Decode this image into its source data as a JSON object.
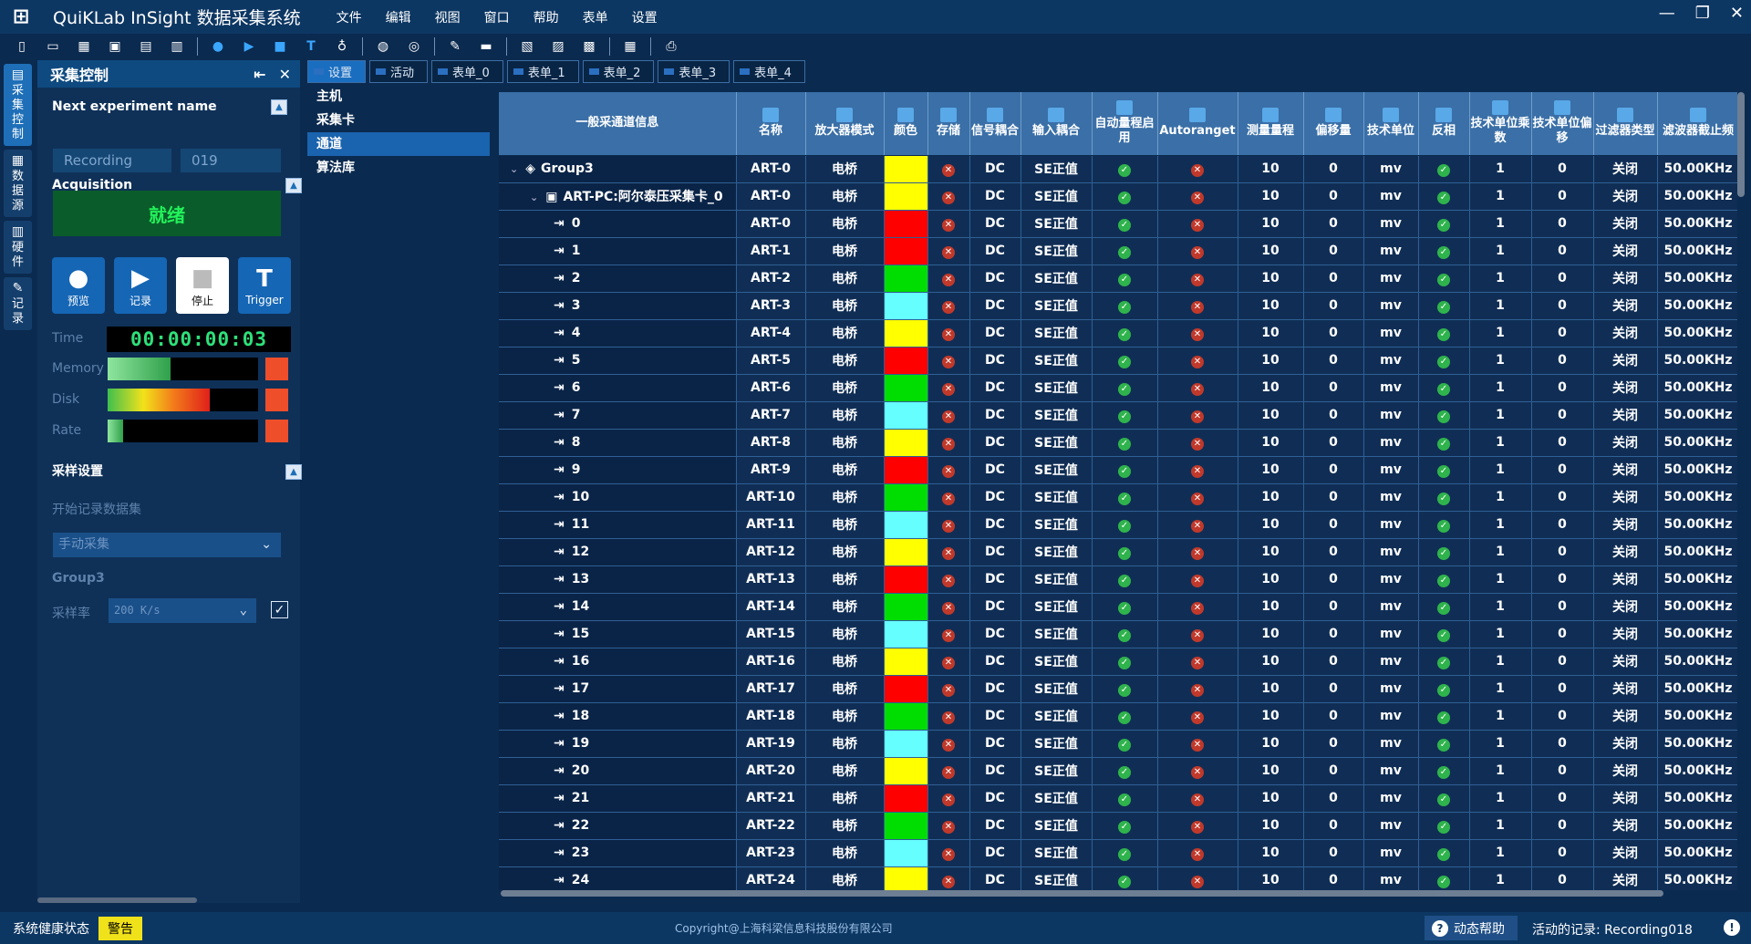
{
  "app": {
    "title": "QuiKLab InSight 数据采集系统",
    "menu": [
      "文件",
      "编辑",
      "视图",
      "窗口",
      "帮助",
      "表单",
      "设置"
    ]
  },
  "toolbar": {
    "icons": [
      "new-file-icon",
      "open-folder-icon",
      "grid-icon",
      "module-icon",
      "save-icon",
      "save-all-icon",
      "record-dot-icon",
      "play-icon",
      "stop-square-icon",
      "trigger-icon",
      "microphone-icon",
      "info-circle-icon",
      "at-circle-icon",
      "pen-icon",
      "print-icon",
      "calendar-1-icon",
      "calendar-2-icon",
      "calendar-3-icon",
      "calculator-icon",
      "printer-icon"
    ]
  },
  "rail": {
    "tabs": [
      {
        "label": "采\n集\n控\n制",
        "active": true
      },
      {
        "label": "数\n据\n源",
        "active": false
      },
      {
        "label": "硬\n件",
        "active": false
      },
      {
        "label": "记\n录",
        "active": false
      }
    ]
  },
  "left_panel": {
    "title": "采集控制",
    "next_experiment_label": "Next experiment name",
    "experiment_name": "Recording",
    "experiment_number": "019",
    "acquisition_label": "Acquisition",
    "status": "就绪",
    "buttons": {
      "preview": "预览",
      "record": "记录",
      "stop": "停止",
      "trigger": "Trigger"
    },
    "time_label": "Time",
    "time_value": "00:00:00:03",
    "memory_label": "Memory",
    "disk_label": "Disk",
    "rate_label": "Rate",
    "memory_level": 0.42,
    "disk_level": 0.68,
    "rate_level": 0.1,
    "sampling_settings_label": "采样设置",
    "start_record_label": "开始记录数据集",
    "mode_value": "手动采集",
    "group_label": "Group3",
    "sample_rate_label": "采样率",
    "sample_rate_value": "200 K/s"
  },
  "tabs": [
    "设置",
    "活动",
    "表单_0",
    "表单_1",
    "表单_2",
    "表单_3",
    "表单_4"
  ],
  "tree": [
    "主机",
    "采集卡",
    "通道",
    "算法库"
  ],
  "grid": {
    "headers": [
      "一般采通道信息",
      "名称",
      "放大器模式",
      "颜色",
      "存储",
      "信号耦合",
      "输入耦合",
      "自动量程启用",
      "Autoranget",
      "测量量程",
      "偏移量",
      "技术单位",
      "反相",
      "技术单位乘数",
      "技术单位偏移",
      "过滤器类型",
      "滤波器截止频"
    ],
    "group_row": {
      "label": "Group3",
      "name": "ART-0"
    },
    "device_row": {
      "label": "ART-PC:阿尔泰压采集卡_0",
      "name": "ART-0"
    },
    "amp_mode": "电桥",
    "signal_coupling": "DC",
    "input_coupling": "SE正值",
    "range": "10",
    "offset": "0",
    "unit": "mv",
    "multiplier": "1",
    "unit_offset": "0",
    "filter": "关闭",
    "cutoff": "50.00KHz",
    "color_cycle": [
      "#ffff00",
      "#ff0000",
      "#00dd00",
      "#66ffff"
    ],
    "channels": [
      {
        "id": "0",
        "name": "ART-0",
        "color": "#ff0000"
      },
      {
        "id": "1",
        "name": "ART-1",
        "color": "#ff0000"
      },
      {
        "id": "2",
        "name": "ART-2",
        "color": "#00dd00"
      },
      {
        "id": "3",
        "name": "ART-3",
        "color": "#66ffff"
      },
      {
        "id": "4",
        "name": "ART-4",
        "color": "#ffff00"
      },
      {
        "id": "5",
        "name": "ART-5",
        "color": "#ff0000"
      },
      {
        "id": "6",
        "name": "ART-6",
        "color": "#00dd00"
      },
      {
        "id": "7",
        "name": "ART-7",
        "color": "#66ffff"
      },
      {
        "id": "8",
        "name": "ART-8",
        "color": "#ffff00"
      },
      {
        "id": "9",
        "name": "ART-9",
        "color": "#ff0000"
      },
      {
        "id": "10",
        "name": "ART-10",
        "color": "#00dd00"
      },
      {
        "id": "11",
        "name": "ART-11",
        "color": "#66ffff"
      },
      {
        "id": "12",
        "name": "ART-12",
        "color": "#ffff00"
      },
      {
        "id": "13",
        "name": "ART-13",
        "color": "#ff0000"
      },
      {
        "id": "14",
        "name": "ART-14",
        "color": "#00dd00"
      },
      {
        "id": "15",
        "name": "ART-15",
        "color": "#66ffff"
      },
      {
        "id": "16",
        "name": "ART-16",
        "color": "#ffff00"
      },
      {
        "id": "17",
        "name": "ART-17",
        "color": "#ff0000"
      },
      {
        "id": "18",
        "name": "ART-18",
        "color": "#00dd00"
      },
      {
        "id": "19",
        "name": "ART-19",
        "color": "#66ffff"
      },
      {
        "id": "20",
        "name": "ART-20",
        "color": "#ffff00"
      },
      {
        "id": "21",
        "name": "ART-21",
        "color": "#ff0000"
      },
      {
        "id": "22",
        "name": "ART-22",
        "color": "#00dd00"
      },
      {
        "id": "23",
        "name": "ART-23",
        "color": "#66ffff"
      },
      {
        "id": "24",
        "name": "ART-24",
        "color": "#ffff00"
      }
    ]
  },
  "status_bar": {
    "health_label": "系统健康状态",
    "warning": "警告",
    "copyright": "Copyright@上海科梁信息科技股份有限公司",
    "help": "动态帮助",
    "active_record_label": "活动的记录:",
    "active_record_value": "Recording018"
  },
  "colors": {
    "accent": "#1a6ec0",
    "background": "#0b2a4f",
    "ready_text": "#22f25a",
    "warning": "#f0e21a"
  }
}
